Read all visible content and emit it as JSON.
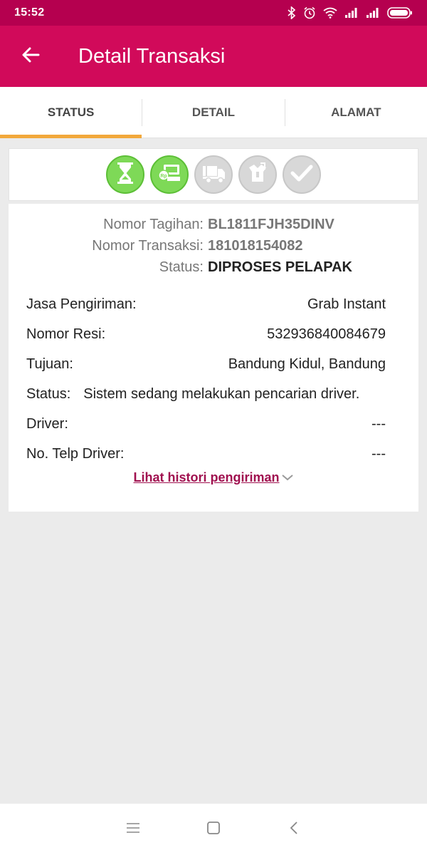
{
  "status_bar": {
    "time": "15:52",
    "icons": [
      "bluetooth-icon",
      "alarm-icon",
      "wifi-icon",
      "signal-icon",
      "signal-icon",
      "battery-icon"
    ]
  },
  "app_bar": {
    "title": "Detail Transaksi",
    "back_icon": "arrow-left-icon"
  },
  "tabs": [
    {
      "label": "STATUS",
      "active": true
    },
    {
      "label": "DETAIL",
      "active": false
    },
    {
      "label": "ALAMAT",
      "active": false
    }
  ],
  "progress": {
    "steps": [
      {
        "icon": "hourglass-icon",
        "done": true
      },
      {
        "icon": "payment-icon",
        "done": true
      },
      {
        "icon": "truck-icon",
        "done": false
      },
      {
        "icon": "package-icon",
        "done": false
      },
      {
        "icon": "check-icon",
        "done": false
      }
    ],
    "colors": {
      "done": "#7ed957",
      "todo": "#d8d8d8"
    }
  },
  "summary": {
    "invoice_label": "Nomor Tagihan:",
    "invoice_value": "BL1811FJH35DINV",
    "transaction_label": "Nomor Transaksi:",
    "transaction_value": "181018154082",
    "status_label": "Status:",
    "status_value": "DIPROSES PELAPAK"
  },
  "shipping": {
    "courier_label": "Jasa Pengiriman:",
    "courier_value": "Grab Instant",
    "receipt_label": "Nomor Resi:",
    "receipt_value": "532936840084679",
    "destination_label": "Tujuan:",
    "destination_value": "Bandung Kidul, Bandung",
    "status_label": "Status:",
    "status_value": "Sistem sedang melakukan pencarian driver.",
    "driver_label": "Driver:",
    "driver_value": "---",
    "driver_phone_label": "No. Telp Driver:",
    "driver_phone_value": "---"
  },
  "history_link": "Lihat histori pengiriman",
  "colors": {
    "status_bar": "#b5004f",
    "app_bar": "#d10a5a",
    "tab_indicator": "#f2a83b",
    "link": "#a0104f"
  }
}
